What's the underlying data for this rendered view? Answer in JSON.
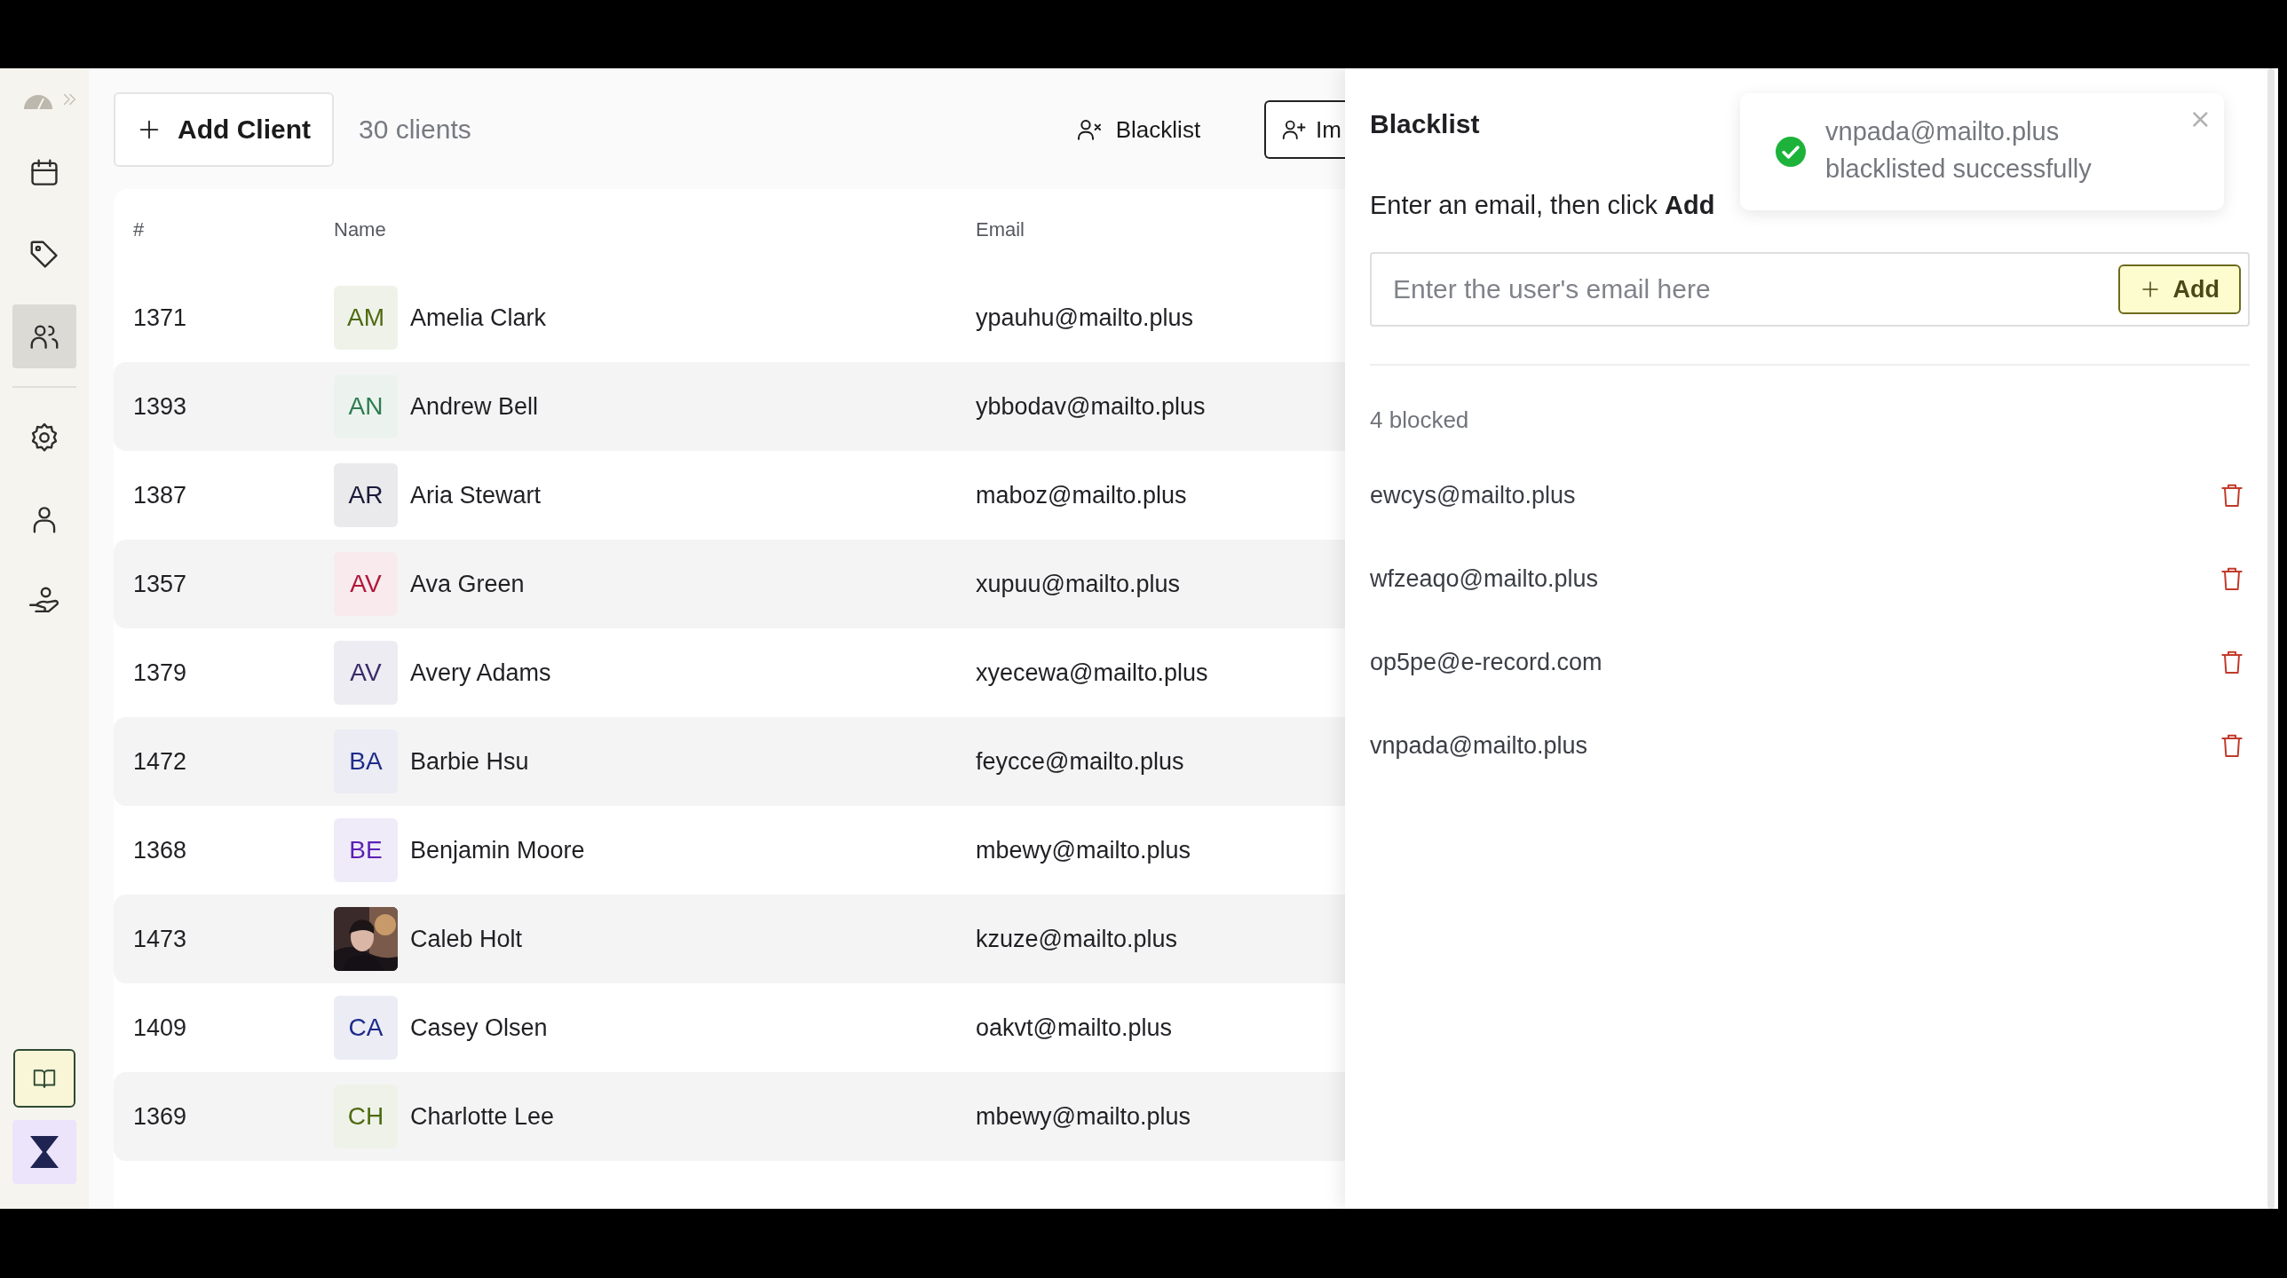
{
  "sidebar": {
    "items": [
      {
        "selected": false
      },
      {
        "selected": false
      },
      {
        "selected": true
      },
      {
        "selected": false
      },
      {
        "selected": false
      },
      {
        "selected": false
      }
    ]
  },
  "toolbar": {
    "add_button": "Add Client",
    "count": "30 clients",
    "blacklist_button": "Blacklist",
    "import_button": "Im"
  },
  "table": {
    "columns": [
      "#",
      "Name",
      "Email"
    ],
    "rows": [
      {
        "id": "1371",
        "kind": "initials",
        "initials": "AM",
        "color": "#4d6b0f",
        "name": "Amelia Clark",
        "email": "ypauhu@mailto.plus"
      },
      {
        "id": "1393",
        "kind": "initials",
        "initials": "AN",
        "color": "#2e7d4f",
        "name": "Andrew Bell",
        "email": "ybbodav@mailto.plus"
      },
      {
        "id": "1387",
        "kind": "initials",
        "initials": "AR",
        "color": "#1a1a3a",
        "name": "Aria Stewart",
        "email": "maboz@mailto.plus"
      },
      {
        "id": "1357",
        "kind": "initials",
        "initials": "AV",
        "color": "#b0183a",
        "name": "Ava Green",
        "email": "xupuu@mailto.plus"
      },
      {
        "id": "1379",
        "kind": "initials",
        "initials": "AV",
        "color": "#3b2a6a",
        "name": "Avery Adams",
        "email": "xyecewa@mailto.plus"
      },
      {
        "id": "1472",
        "kind": "initials",
        "initials": "BA",
        "color": "#1f2c8a",
        "name": "Barbie Hsu",
        "email": "feycce@mailto.plus"
      },
      {
        "id": "1368",
        "kind": "initials",
        "initials": "BE",
        "color": "#5b21b6",
        "name": "Benjamin Moore",
        "email": "mbewy@mailto.plus"
      },
      {
        "id": "1473",
        "kind": "picture",
        "name": "Caleb Holt",
        "email": "kzuze@mailto.plus"
      },
      {
        "id": "1409",
        "kind": "initials",
        "initials": "CA",
        "color": "#1d2a8a",
        "name": "Casey Olsen",
        "email": "oakvt@mailto.plus"
      },
      {
        "id": "1369",
        "kind": "initials",
        "initials": "CH",
        "color": "#4d6b0f",
        "name": "Charlotte Lee",
        "email": "mbewy@mailto.plus"
      }
    ]
  },
  "blacklist_panel": {
    "title": "Blacklist",
    "description": "Enter an email, then click **Add**",
    "email_field": {
      "placeholder": "Enter the user's email here"
    },
    "add_button": "Add",
    "count": "4 blocked",
    "entries": [
      "ewcys@mailto.plus",
      "wfzeaqo@mailto.plus",
      "op5pe@e-record.com",
      "vnpada@mailto.plus"
    ]
  },
  "toast": {
    "message": "vnpada@mailto.plus blacklisted successfully",
    "close": "×"
  }
}
